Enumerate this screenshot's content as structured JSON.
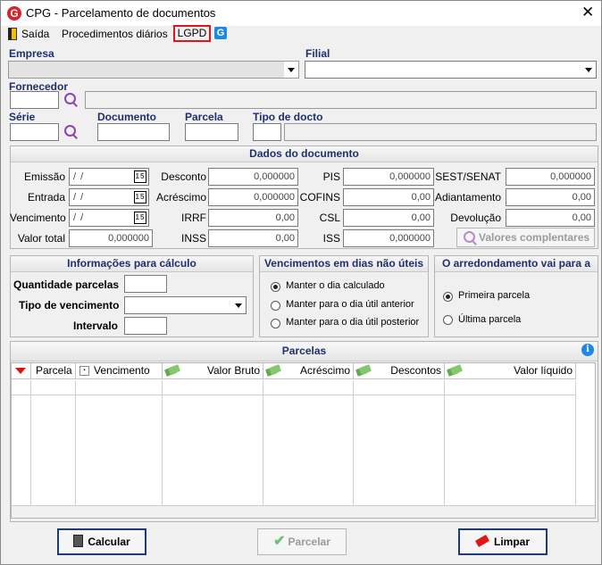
{
  "window": {
    "title": "CPG - Parcelamento de documentos",
    "logo_letter": "G"
  },
  "menu": {
    "exit": "Saída",
    "daily": "Procedimentos diários",
    "lgpd": "LGPD",
    "help_letter": "G"
  },
  "header": {
    "empresa_label": "Empresa",
    "filial_label": "Filial",
    "fornecedor_label": "Fornecedor",
    "serie_label": "Série",
    "documento_label": "Documento",
    "parcela_label": "Parcela",
    "tipo_docto_label": "Tipo de docto"
  },
  "dados": {
    "title": "Dados do documento",
    "emissao_label": "Emissão",
    "emissao_value": "/ /",
    "entrada_label": "Entrada",
    "entrada_value": "/ /",
    "vencimento_label": "Vencimento",
    "vencimento_value": "/ /",
    "valor_total_label": "Valor total",
    "valor_total_value": "0,000000",
    "desconto_label": "Desconto",
    "desconto_value": "0,000000",
    "acrescimo_label": "Acréscimo",
    "acrescimo_value": "0,000000",
    "irrf_label": "IRRF",
    "irrf_value": "0,00",
    "inss_label": "INSS",
    "inss_value": "0,00",
    "pis_label": "PIS",
    "pis_value": "0,000000",
    "cofins_label": "COFINS",
    "cofins_value": "0,00",
    "csl_label": "CSL",
    "csl_value": "0,00",
    "iss_label": "ISS",
    "iss_value": "0,000000",
    "sest_label": "SEST/SENAT",
    "sest_value": "0,000000",
    "adiantamento_label": "Adiantamento",
    "adiantamento_value": "0,00",
    "devolucao_label": "Devolução",
    "devolucao_value": "0,00",
    "valores_btn": "Valores complentares",
    "cal_glyph": "15"
  },
  "calculo": {
    "title": "Informações para cálculo",
    "qtd_label": "Quantidade parcelas",
    "tipo_label": "Tipo de vencimento",
    "intervalo_label": "Intervalo"
  },
  "vencimentos": {
    "title": "Vencimentos em dias não úteis",
    "opt1": "Manter o dia calculado",
    "opt2": "Manter para o dia útil anterior",
    "opt3": "Manter para o dia útil posterior"
  },
  "arredonda": {
    "title": "O arredondamento vai para a",
    "opt1": "Primeira parcela",
    "opt2": "Última parcela"
  },
  "parcelas": {
    "title": "Parcelas",
    "info_glyph": "i",
    "columns": [
      "Parcela",
      "Vencimento",
      "Valor Bruto",
      "Acréscimo",
      "Descontos",
      "Valor líquido"
    ]
  },
  "buttons": {
    "calcular": "Calcular",
    "parcelar": "Parcelar",
    "limpar": "Limpar"
  },
  "colors": {
    "brand_red": "#d8232a",
    "label_blue": "#1f2f6b",
    "lgpd_border": "#e0161b"
  }
}
